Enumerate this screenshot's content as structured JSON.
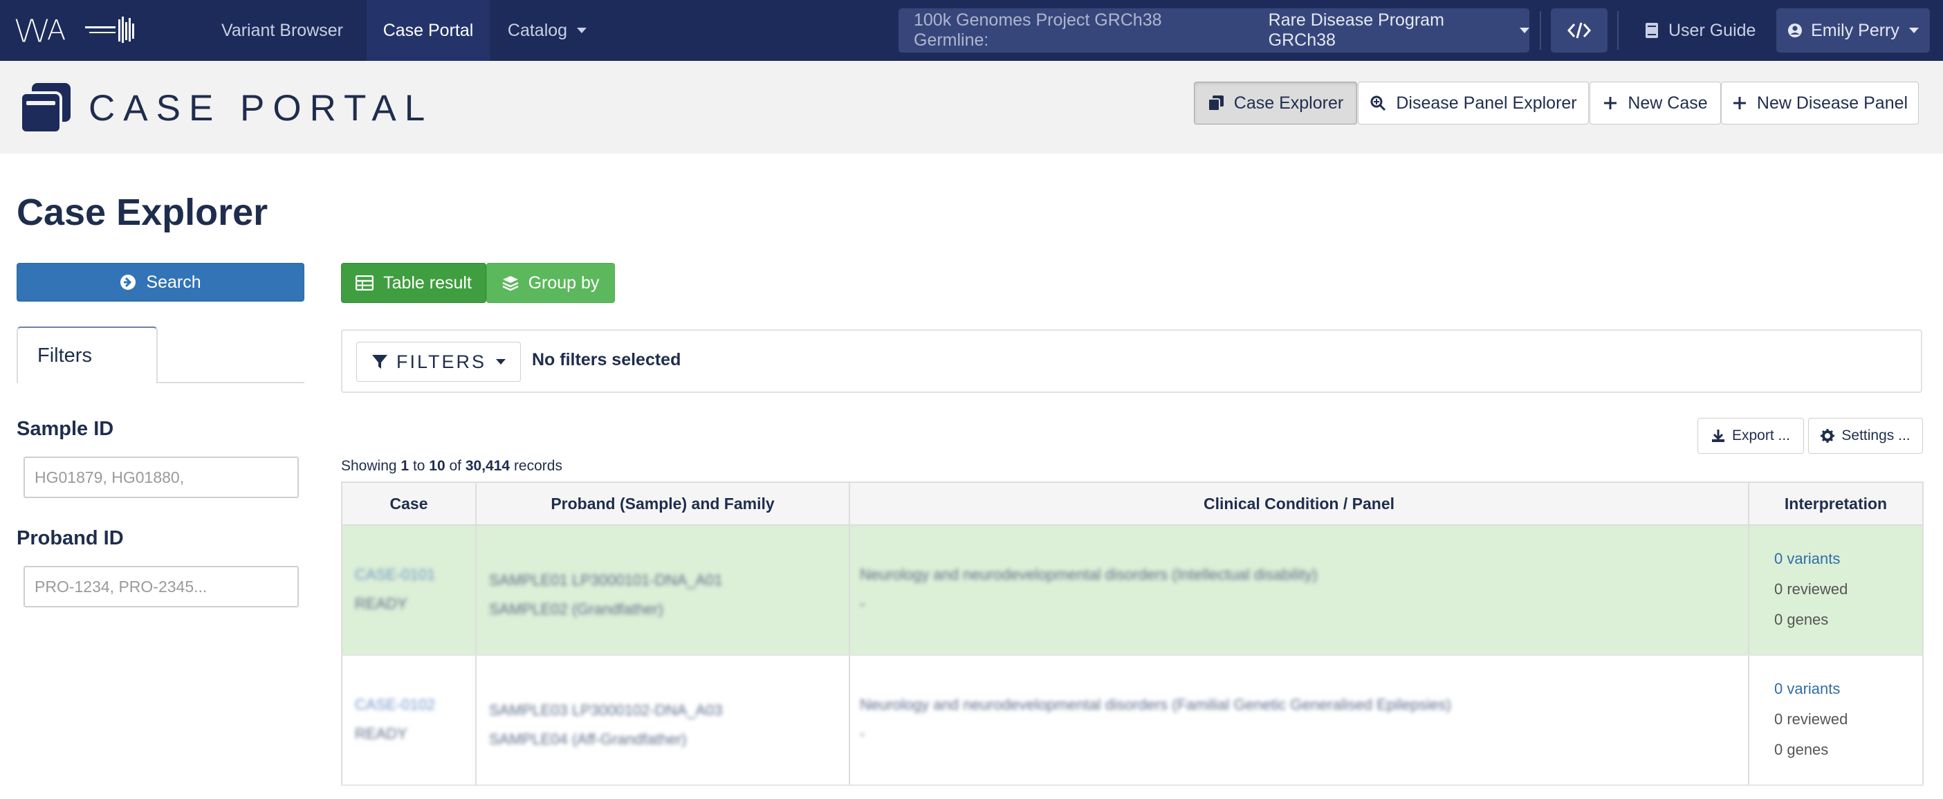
{
  "navbar": {
    "items": [
      {
        "label": "Variant Browser"
      },
      {
        "label": "Case Portal"
      },
      {
        "label": "Catalog"
      }
    ],
    "project_label": "100k Genomes Project GRCh38 Germline:",
    "project_value": "Rare Disease Program GRCh38",
    "user_guide": "User Guide",
    "user_name": "Emily Perry"
  },
  "header": {
    "title": "CASE PORTAL",
    "buttons": [
      {
        "label": "Case Explorer"
      },
      {
        "label": "Disease Panel Explorer"
      },
      {
        "label": "New Case"
      },
      {
        "label": "New Disease Panel"
      }
    ]
  },
  "page": {
    "title": "Case Explorer"
  },
  "left_panel": {
    "search_label": "Search",
    "filters_tab": "Filters",
    "sample_id_label": "Sample ID",
    "sample_id_placeholder": "HG01879, HG01880,",
    "proband_id_label": "Proband ID",
    "proband_id_placeholder": "PRO-1234, PRO-2345..."
  },
  "toolbar": {
    "table_result": "Table result",
    "group_by": "Group by",
    "filters_dropdown": "FILTERS",
    "no_filters": "No filters selected",
    "export": "Export ...",
    "settings": "Settings ..."
  },
  "showing": {
    "prefix": "Showing",
    "from": "1",
    "to_word": "to",
    "to": "10",
    "of_word": "of",
    "total": "30,414",
    "suffix": "records"
  },
  "table": {
    "columns": [
      "Case",
      "Proband (Sample) and Family",
      "Clinical Condition / Panel",
      "Interpretation"
    ],
    "rows": [
      {
        "case_id": "CASE-0101",
        "case_sub": "READY",
        "proband_1": "SAMPLE01 LP3000101-DNA_A01",
        "proband_2": "SAMPLE02 (Grandfather)",
        "clinical": "Neurology and neurodevelopmental disorders (Intellectual disability)",
        "clinical_sub": "-",
        "variants": "0 variants",
        "reviewed": "0 reviewed",
        "genes": "0 genes"
      },
      {
        "case_id": "CASE-0102",
        "case_sub": "READY",
        "proband_1": "SAMPLE03 LP3000102-DNA_A03",
        "proband_2": "SAMPLE04 (Aff-Grandfather)",
        "clinical": "Neurology and neurodevelopmental disorders (Familial Genetic Generalised Epilepsies)",
        "clinical_sub": "-",
        "variants": "0 variants",
        "reviewed": "0 reviewed",
        "genes": "0 genes"
      }
    ]
  }
}
